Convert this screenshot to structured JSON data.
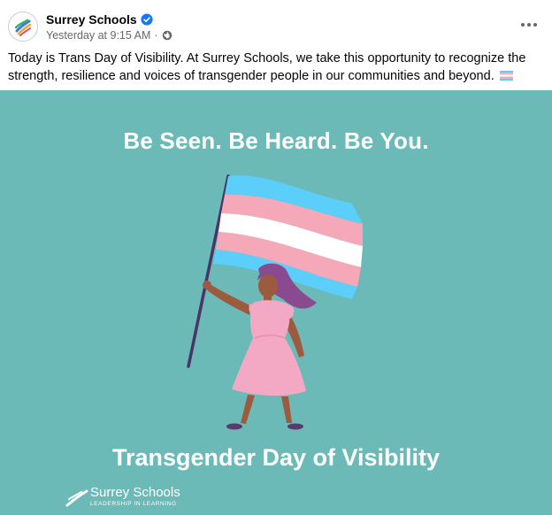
{
  "post": {
    "author": "Surrey Schools",
    "timestamp": "Yesterday at 9:15 AM",
    "separator": "·",
    "text": "Today is Trans Day of Visibility. At Surrey Schools, we take this opportunity to recognize the strength, resilience and voices of transgender people in our communities and beyond."
  },
  "image": {
    "headline": "Be Seen. Be Heard. Be You.",
    "tagline": "Transgender Day of Visibility",
    "logo_name": "Surrey Schools",
    "logo_subtitle": "LEADERSHIP IN LEARNING"
  },
  "colors": {
    "background_teal": "#6bbab8",
    "flag_blue": "#5bcefa",
    "flag_pink": "#f5a9b8",
    "flag_white": "#ffffff",
    "verified_blue": "#1877f2"
  },
  "icons": [
    "verified-badge-icon",
    "globe-icon",
    "more-options-icon",
    "trans-flag-emoji"
  ]
}
